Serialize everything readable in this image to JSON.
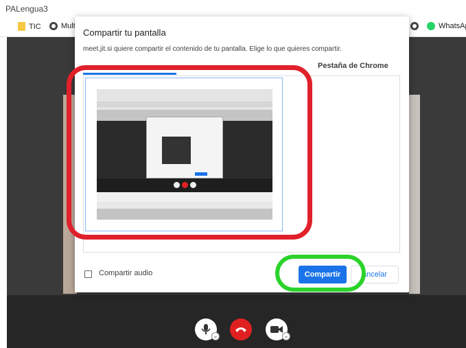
{
  "browser": {
    "title": "PALengua3",
    "bookmarks": [
      {
        "label": "TIC",
        "icon": "folder-icon"
      },
      {
        "label": "Mult",
        "icon": "globe-icon"
      },
      {
        "label": "WhatsAp",
        "icon": "whatsapp-icon"
      }
    ]
  },
  "dialog": {
    "title": "Compartir tu pantalla",
    "subtitle": "meet.jit.si quiere compartir el contenido de tu pantalla. Elige lo que quieres compartir.",
    "tabs": [
      {
        "label": "Pestaña de Chrome",
        "active": false
      }
    ],
    "share_audio_label": "Compartir audio",
    "share_audio_checked": false,
    "share_button": "Compartir",
    "cancel_button": "ancelar"
  },
  "colors": {
    "accent": "#1a73e8",
    "annotation_red": "#e0202a",
    "annotation_green": "#2bd32b",
    "hangup": "#e02020"
  },
  "controls": [
    {
      "name": "microphone-icon"
    },
    {
      "name": "hangup-icon"
    },
    {
      "name": "camera-icon"
    }
  ]
}
